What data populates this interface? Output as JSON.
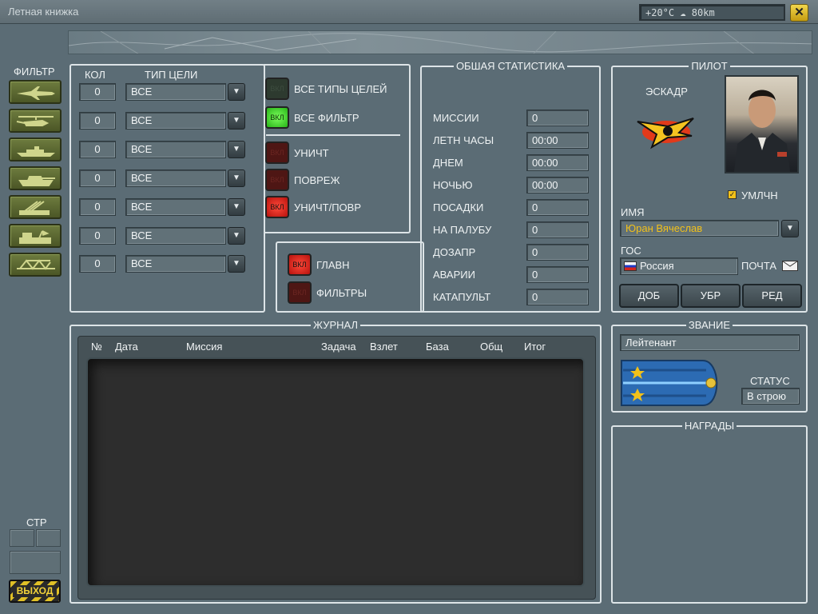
{
  "window": {
    "title": "Летная книжка",
    "weather": "+20°C ☁ 80km",
    "close_label": "✕"
  },
  "filter": {
    "title": "ФИЛЬТР",
    "kol_header": "КОЛ",
    "type_header": "ТИП ЦЕЛИ",
    "rows": [
      {
        "icon": "jet-icon",
        "count": "0",
        "type": "ВСЕ"
      },
      {
        "icon": "helicopter-icon",
        "count": "0",
        "type": "ВСЕ"
      },
      {
        "icon": "ship-icon",
        "count": "0",
        "type": "ВСЕ"
      },
      {
        "icon": "tank-icon",
        "count": "0",
        "type": "ВСЕ"
      },
      {
        "icon": "sam-launcher-icon",
        "count": "0",
        "type": "ВСЕ"
      },
      {
        "icon": "radar-truck-icon",
        "count": "0",
        "type": "ВСЕ"
      },
      {
        "icon": "bridge-icon",
        "count": "0",
        "type": "ВСЕ"
      }
    ],
    "toggles": [
      {
        "label": "ВСЕ ТИПЫ ЦЕЛЕЙ",
        "led_text": "ВКЛ",
        "state": "off-green"
      },
      {
        "label": "ВСЕ ФИЛЬТР",
        "led_text": "ВКЛ",
        "state": "on-green"
      },
      {
        "label": "УНИЧТ",
        "led_text": "ВКЛ",
        "state": "off-red"
      },
      {
        "label": "ПОВРЕЖ",
        "led_text": "ВКЛ",
        "state": "off-red"
      },
      {
        "label": "УНИЧТ/ПОВР",
        "led_text": "ВКЛ",
        "state": "on-red"
      }
    ],
    "mode": [
      {
        "label": "ГЛАВН",
        "led_text": "ВКЛ",
        "state": "on-red"
      },
      {
        "label": "ФИЛЬТРЫ",
        "led_text": "ВКЛ",
        "state": "off-red"
      }
    ]
  },
  "stats": {
    "title": "ОБШАЯ СТАТИСТИКА",
    "rows": [
      {
        "label": "МИССИИ",
        "value": "0"
      },
      {
        "label": "ЛЕТН ЧАСЫ",
        "value": "00:00"
      },
      {
        "label": "ДНЕМ",
        "value": "00:00"
      },
      {
        "label": "НОЧЬЮ",
        "value": "00:00"
      },
      {
        "label": "ПОСАДКИ",
        "value": "0"
      },
      {
        "label": "НА ПАЛУБУ",
        "value": "0"
      },
      {
        "label": "ДОЗАПР",
        "value": "0"
      },
      {
        "label": "АВАРИИ",
        "value": "0"
      },
      {
        "label": "КАТАПУЛЬТ",
        "value": "0"
      }
    ]
  },
  "pilot": {
    "title": "ПИЛОТ",
    "squadron_label": "ЭСКАДР",
    "default_label": "УМЛЧН",
    "default_checked": true,
    "name_label": "ИМЯ",
    "name_value": "Юран Вячеслав",
    "country_label": "ГОС",
    "country_value": "Россия",
    "mail_label": "ПОЧТА",
    "buttons": [
      "ДОБ",
      "УБР",
      "РЕД"
    ]
  },
  "journal": {
    "title": "ЖУРНАЛ",
    "columns": [
      "№",
      "Дата",
      "Миссия",
      "Задача",
      "Взлет",
      "База",
      "Общ",
      "Итог"
    ]
  },
  "rank": {
    "title": "ЗВАНИЕ",
    "value": "Лейтенант",
    "status_label": "СТАТУС",
    "status_value": "В строю"
  },
  "awards": {
    "title": "НАГРАДЫ"
  },
  "page": {
    "label": "СТР"
  },
  "exit": {
    "label": "ВЫХОД"
  },
  "colors": {
    "accent_yellow": "#f2c11a",
    "led_green": "#3adf22",
    "led_red": "#e4201a",
    "background": "#5b6c75"
  }
}
